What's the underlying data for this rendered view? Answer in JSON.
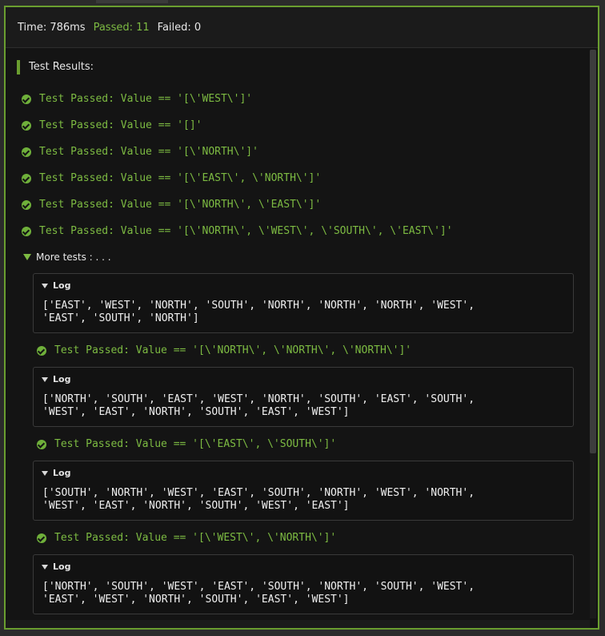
{
  "header": {
    "time": "Time: 786ms",
    "passed": "Passed: 11",
    "failed": "Failed: 0"
  },
  "results_title": "Test Results:",
  "tests_top": [
    "Test Passed: Value == '[\\'WEST\\']'",
    "Test Passed: Value == '[]'",
    "Test Passed: Value == '[\\'NORTH\\']'",
    "Test Passed: Value == '[\\'EAST\\', \\'NORTH\\']'",
    "Test Passed: Value == '[\\'NORTH\\', \\'EAST\\']'",
    "Test Passed: Value == '[\\'NORTH\\', \\'WEST\\', \\'SOUTH\\', \\'EAST\\']'"
  ],
  "more_tests_label": "More tests : . . .",
  "log_label": "Log",
  "logs": [
    "['EAST', 'WEST', 'NORTH', 'SOUTH', 'NORTH', 'NORTH', 'NORTH', 'WEST',\n'EAST', 'SOUTH', 'NORTH']",
    "['NORTH', 'SOUTH', 'EAST', 'WEST', 'NORTH', 'SOUTH', 'EAST', 'SOUTH',\n'WEST', 'EAST', 'NORTH', 'SOUTH', 'EAST', 'WEST']",
    "['SOUTH', 'NORTH', 'WEST', 'EAST', 'SOUTH', 'NORTH', 'WEST', 'NORTH',\n'WEST', 'EAST', 'NORTH', 'SOUTH', 'WEST', 'EAST']",
    "['NORTH', 'SOUTH', 'WEST', 'EAST', 'SOUTH', 'NORTH', 'SOUTH', 'WEST',\n'EAST', 'WEST', 'NORTH', 'SOUTH', 'EAST', 'WEST']"
  ],
  "tests_more": [
    "Test Passed: Value == '[\\'NORTH\\', \\'NORTH\\', \\'NORTH\\']'",
    "Test Passed: Value == '[\\'EAST\\', \\'SOUTH\\']'",
    "Test Passed: Value == '[\\'WEST\\', \\'NORTH\\']'"
  ],
  "colors": {
    "accent": "#6a9e2f",
    "pass_text": "#7dbb42",
    "background": "#141414"
  },
  "icons": {
    "pass": "check-circle-icon",
    "expand": "caret-down-icon"
  }
}
